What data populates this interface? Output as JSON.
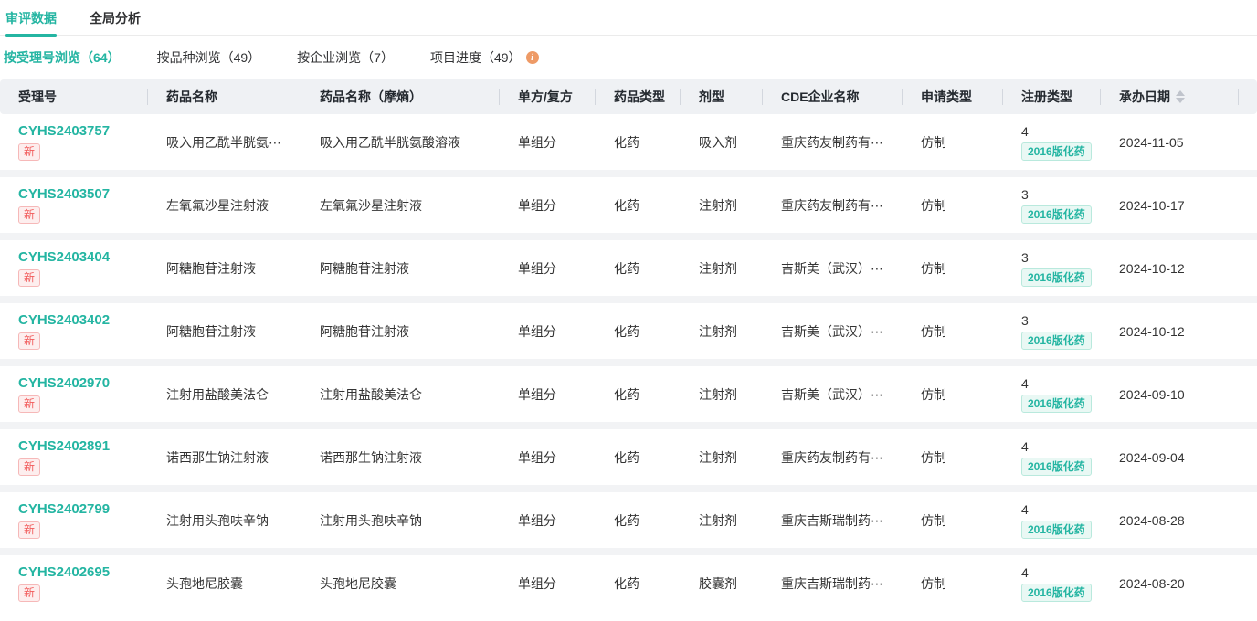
{
  "accent_color": "#24b5a2",
  "top_tabs": {
    "review_data": "审评数据",
    "global_analysis": "全局分析"
  },
  "sub_tabs": {
    "by_acceptance_no": "按受理号浏览（64）",
    "by_variety": "按品种浏览（49）",
    "by_company": "按企业浏览（7）",
    "project_progress": "项目进度（49）"
  },
  "icons": {
    "info": "info-circle",
    "sort": "sort-carets",
    "info_glyph": "i"
  },
  "table": {
    "columns": {
      "acceptance_no": "受理号",
      "drug_name": "药品名称",
      "drug_name_mh": "药品名称（摩熵）",
      "formula": "单方/复方",
      "drug_type": "药品类型",
      "dosage_form": "剂型",
      "cde_company": "CDE企业名称",
      "application_type": "申请类型",
      "registration_type": "注册类型",
      "acceptance_date": "承办日期"
    },
    "rows": [
      {
        "acceptance_no": "CYHS2403757",
        "new_badge": "新",
        "drug_name": "吸入用乙酰半胱氨⋯",
        "drug_name_mh": "吸入用乙酰半胱氨酸溶液",
        "formula": "单组分",
        "drug_type": "化药",
        "dosage_form": "吸入剂",
        "cde_company": "重庆药友制药有⋯",
        "application_type": "仿制",
        "reg_class": "4",
        "reg_tag": "2016版化药",
        "date": "2024-11-05"
      },
      {
        "acceptance_no": "CYHS2403507",
        "new_badge": "新",
        "drug_name": "左氧氟沙星注射液",
        "drug_name_mh": "左氧氟沙星注射液",
        "formula": "单组分",
        "drug_type": "化药",
        "dosage_form": "注射剂",
        "cde_company": "重庆药友制药有⋯",
        "application_type": "仿制",
        "reg_class": "3",
        "reg_tag": "2016版化药",
        "date": "2024-10-17"
      },
      {
        "acceptance_no": "CYHS2403404",
        "new_badge": "新",
        "drug_name": "阿糖胞苷注射液",
        "drug_name_mh": "阿糖胞苷注射液",
        "formula": "单组分",
        "drug_type": "化药",
        "dosage_form": "注射剂",
        "cde_company": "吉斯美（武汉）⋯",
        "application_type": "仿制",
        "reg_class": "3",
        "reg_tag": "2016版化药",
        "date": "2024-10-12"
      },
      {
        "acceptance_no": "CYHS2403402",
        "new_badge": "新",
        "drug_name": "阿糖胞苷注射液",
        "drug_name_mh": "阿糖胞苷注射液",
        "formula": "单组分",
        "drug_type": "化药",
        "dosage_form": "注射剂",
        "cde_company": "吉斯美（武汉）⋯",
        "application_type": "仿制",
        "reg_class": "3",
        "reg_tag": "2016版化药",
        "date": "2024-10-12"
      },
      {
        "acceptance_no": "CYHS2402970",
        "new_badge": "新",
        "drug_name": "注射用盐酸美法仑",
        "drug_name_mh": "注射用盐酸美法仑",
        "formula": "单组分",
        "drug_type": "化药",
        "dosage_form": "注射剂",
        "cde_company": "吉斯美（武汉）⋯",
        "application_type": "仿制",
        "reg_class": "4",
        "reg_tag": "2016版化药",
        "date": "2024-09-10"
      },
      {
        "acceptance_no": "CYHS2402891",
        "new_badge": "新",
        "drug_name": "诺西那生钠注射液",
        "drug_name_mh": "诺西那生钠注射液",
        "formula": "单组分",
        "drug_type": "化药",
        "dosage_form": "注射剂",
        "cde_company": "重庆药友制药有⋯",
        "application_type": "仿制",
        "reg_class": "4",
        "reg_tag": "2016版化药",
        "date": "2024-09-04"
      },
      {
        "acceptance_no": "CYHS2402799",
        "new_badge": "新",
        "drug_name": "注射用头孢呋辛钠",
        "drug_name_mh": "注射用头孢呋辛钠",
        "formula": "单组分",
        "drug_type": "化药",
        "dosage_form": "注射剂",
        "cde_company": "重庆吉斯瑞制药⋯",
        "application_type": "仿制",
        "reg_class": "4",
        "reg_tag": "2016版化药",
        "date": "2024-08-28"
      },
      {
        "acceptance_no": "CYHS2402695",
        "new_badge": "新",
        "drug_name": "头孢地尼胶囊",
        "drug_name_mh": "头孢地尼胶囊",
        "formula": "单组分",
        "drug_type": "化药",
        "dosage_form": "胶囊剂",
        "cde_company": "重庆吉斯瑞制药⋯",
        "application_type": "仿制",
        "reg_class": "4",
        "reg_tag": "2016版化药",
        "date": "2024-08-20"
      }
    ]
  }
}
